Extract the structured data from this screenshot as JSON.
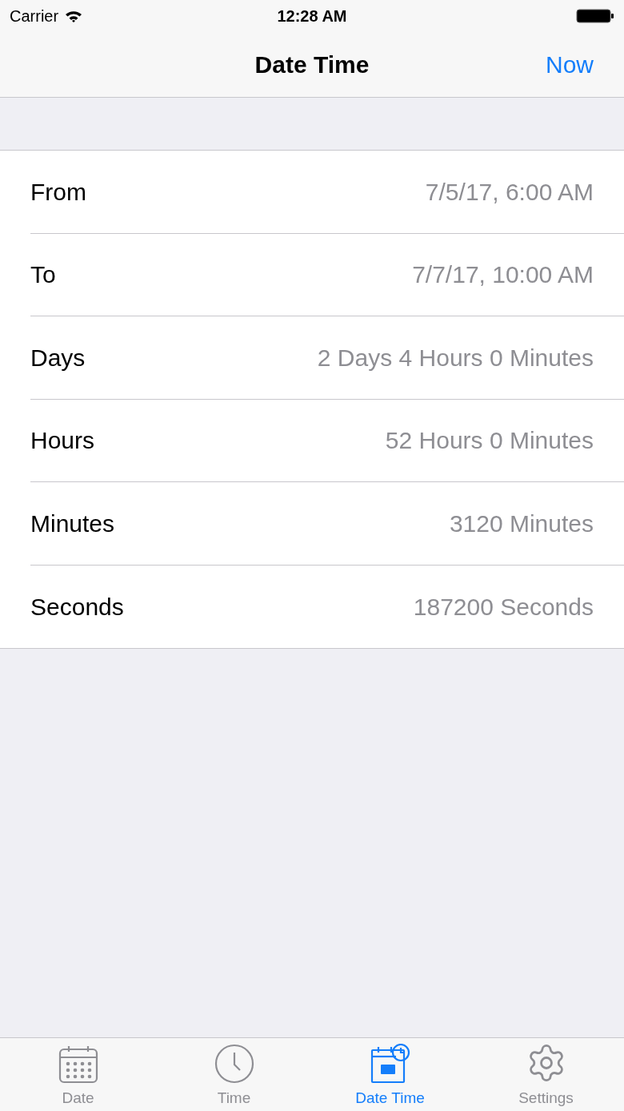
{
  "status_bar": {
    "carrier": "Carrier",
    "time": "12:28 AM"
  },
  "nav": {
    "title": "Date Time",
    "action": "Now"
  },
  "rows": [
    {
      "label": "From",
      "value": "7/5/17, 6:00 AM"
    },
    {
      "label": "To",
      "value": "7/7/17, 10:00 AM"
    },
    {
      "label": "Days",
      "value": "2 Days 4 Hours 0 Minutes"
    },
    {
      "label": "Hours",
      "value": "52 Hours 0 Minutes"
    },
    {
      "label": "Minutes",
      "value": "3120 Minutes"
    },
    {
      "label": "Seconds",
      "value": "187200 Seconds"
    }
  ],
  "tabs": [
    {
      "label": "Date",
      "kind": "calendar",
      "selected": false
    },
    {
      "label": "Time",
      "kind": "clock",
      "selected": false
    },
    {
      "label": "Date Time",
      "kind": "calendar-clock",
      "selected": true
    },
    {
      "label": "Settings",
      "kind": "gear",
      "selected": false
    }
  ]
}
